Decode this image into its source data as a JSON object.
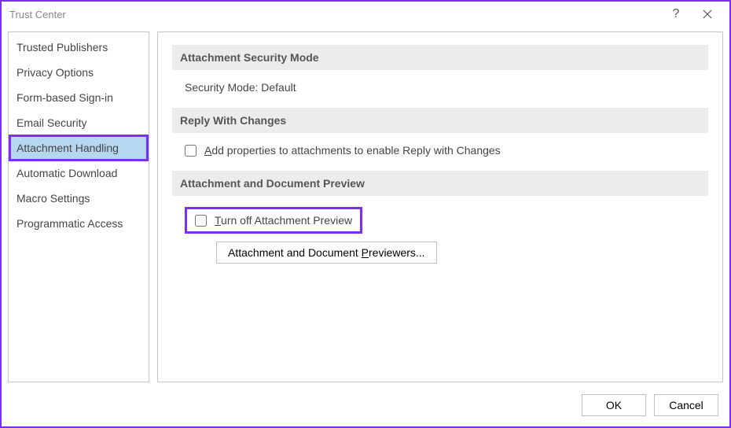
{
  "window": {
    "title": "Trust Center"
  },
  "sidebar": {
    "items": [
      {
        "label": "Trusted Publishers",
        "selected": false
      },
      {
        "label": "Privacy Options",
        "selected": false
      },
      {
        "label": "Form-based Sign-in",
        "selected": false
      },
      {
        "label": "Email Security",
        "selected": false
      },
      {
        "label": "Attachment Handling",
        "selected": true
      },
      {
        "label": "Automatic Download",
        "selected": false
      },
      {
        "label": "Macro Settings",
        "selected": false
      },
      {
        "label": "Programmatic Access",
        "selected": false
      }
    ]
  },
  "content": {
    "section1": {
      "header": "Attachment Security Mode",
      "mode_label": "Security Mode:",
      "mode_value": "Default"
    },
    "section2": {
      "header": "Reply With Changes",
      "checkbox_accel": "A",
      "checkbox_label_rest": "dd properties to attachments to enable Reply with Changes",
      "checked": false
    },
    "section3": {
      "header": "Attachment and Document Preview",
      "checkbox_accel": "T",
      "checkbox_label_rest": "urn off Attachment Preview",
      "checked": false,
      "button_pre": "Attachment and Document ",
      "button_accel": "P",
      "button_post": "reviewers..."
    }
  },
  "footer": {
    "ok": "OK",
    "cancel": "Cancel"
  }
}
